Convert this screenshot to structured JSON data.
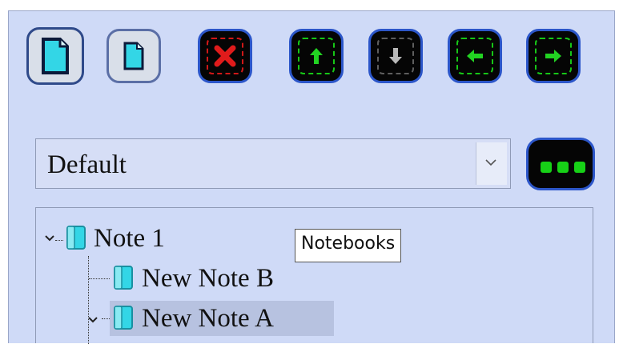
{
  "toolbar": {
    "buttons": [
      {
        "name": "new-notebook",
        "icon": "document-icon"
      },
      {
        "name": "new-sub-note",
        "icon": "document-icon"
      },
      {
        "name": "delete",
        "icon": "red-x-icon"
      },
      {
        "name": "move-up",
        "icon": "arrow-up-icon"
      },
      {
        "name": "move-down",
        "icon": "arrow-down-icon"
      },
      {
        "name": "move-left",
        "icon": "arrow-left-icon"
      },
      {
        "name": "move-right",
        "icon": "arrow-right-icon"
      }
    ]
  },
  "notebook_select": {
    "selected": "Default"
  },
  "more_button": {
    "icon": "ellipsis-icon"
  },
  "tooltip": {
    "text": "Notebooks"
  },
  "tree": {
    "nodes": [
      {
        "label": "Note 1",
        "expanded": true,
        "level": 0
      },
      {
        "label": "New Note B",
        "expanded": false,
        "level": 1
      },
      {
        "label": "New Note A",
        "expanded": true,
        "level": 1,
        "selected": true
      }
    ]
  },
  "colors": {
    "panel_bg": "#cfdaf7",
    "button_dark": "#050505",
    "button_border": "#2c56c9",
    "accent_green": "#17c717",
    "accent_red": "#d01818",
    "icon_cyan": "#33d6e6"
  }
}
